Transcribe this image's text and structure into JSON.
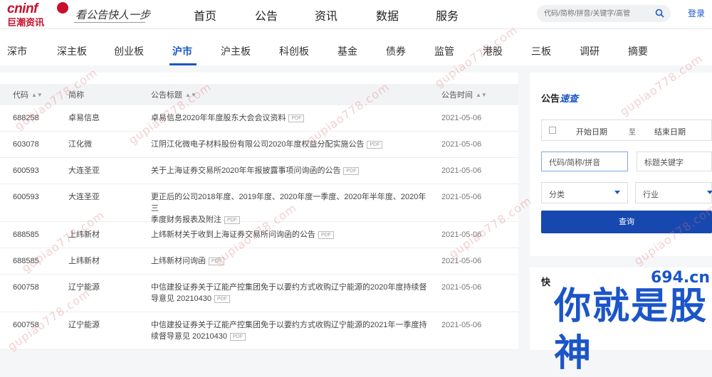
{
  "header": {
    "logo_en": "cninf",
    "logo_cn": "巨潮资讯",
    "slogan": "看公告快人一步",
    "nav": [
      "首页",
      "公告",
      "资讯",
      "数据",
      "服务"
    ],
    "search_placeholder": "代码/简称/拼音/关键字/高管",
    "login": "登录"
  },
  "subnav": {
    "items": [
      "深市",
      "深主板",
      "创业板",
      "沪市",
      "沪主板",
      "科创板",
      "基金",
      "债券",
      "监管",
      "港股",
      "三板",
      "调研",
      "摘要"
    ],
    "active": "沪市"
  },
  "table": {
    "headers": {
      "code": "代码",
      "name": "简称",
      "title": "公告标题",
      "time": "公告时间"
    },
    "sort_glyph": "▲▼",
    "pdf_label": "PDF",
    "rows": [
      {
        "code": "688258",
        "name": "卓易信息",
        "title": [
          "卓易信息2020年年度股东大会会议资料"
        ],
        "time": "2021-05-06"
      },
      {
        "code": "603078",
        "name": "江化微",
        "title": [
          "江阴江化微电子材料股份有限公司2020年度权益分配实施公告"
        ],
        "time": "2021-05-06"
      },
      {
        "code": "600593",
        "name": "大连圣亚",
        "title": [
          "关于上海证券交易所2020年年报披露事项问询函的公告"
        ],
        "time": "2021-05-06"
      },
      {
        "code": "600593",
        "name": "大连圣亚",
        "title": [
          "更正后的公司2018年度、2019年度、2020年度一季度、2020年半年度、2020年三",
          "季度财务报表及附注"
        ],
        "time": "2021-05-06"
      },
      {
        "code": "688585",
        "name": "上纬新材",
        "title": [
          "上纬新材关于收到上海证券交易所问询函的公告"
        ],
        "time": "2021-05-06"
      },
      {
        "code": "688585",
        "name": "上纬新材",
        "title": [
          "上纬新材问询函"
        ],
        "time": "2021-05-06"
      },
      {
        "code": "600758",
        "name": "辽宁能源",
        "title": [
          "中信建投证券关于辽能产控集团免于以要约方式收购辽宁能源的2020年度持续督",
          "导意见 20210430"
        ],
        "time": "2021-05-06"
      },
      {
        "code": "600758",
        "name": "辽宁能源",
        "title": [
          "中信建投证券关于辽能产控集团免于以要约方式收购辽宁能源的2021年一季度持",
          "续督导意见 20210430"
        ],
        "time": "2021-05-06"
      }
    ]
  },
  "sidebar": {
    "title_prefix": "公告",
    "title_accent": "速查",
    "date_start": "开始日期",
    "date_sep": "至",
    "date_end": "结束日期",
    "code_placeholder": "代码/简称/拼音",
    "keyword_placeholder": "标题关键字",
    "category": "分类",
    "industry": "行业",
    "query_button": "查询",
    "quick_label": "快"
  },
  "watermark": {
    "site": "694.cn",
    "big_text": "你就是股神",
    "diagonal": "gupiao778.com"
  }
}
